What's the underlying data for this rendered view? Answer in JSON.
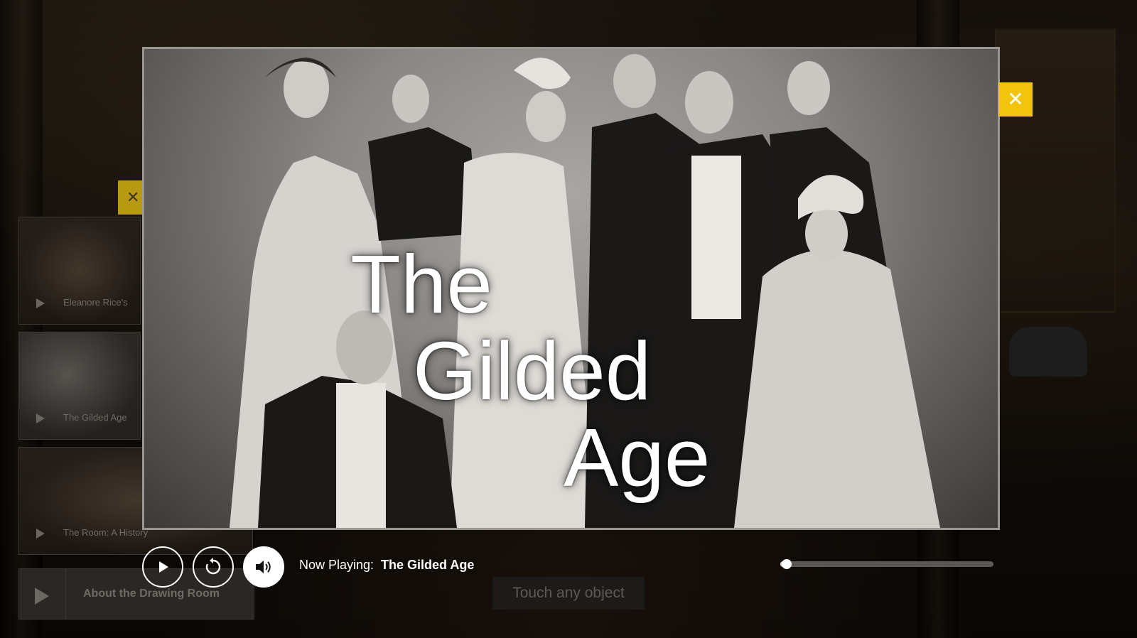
{
  "video": {
    "title_lines": [
      "The",
      "Gilded",
      "Age"
    ]
  },
  "sidebar": {
    "items": [
      {
        "label": "Eleanore Rice's"
      },
      {
        "label": "The Gilded Age"
      },
      {
        "label": "The Room: A History"
      }
    ],
    "about_label": "About the Drawing Room"
  },
  "prompt": "Touch any object",
  "player": {
    "now_playing_label": "Now Playing:",
    "now_playing_title": "The Gilded Age",
    "progress": 0.03
  },
  "colors": {
    "accent": "#f2c40c",
    "control_border": "#ffffff"
  },
  "icons": {
    "close": "close-icon",
    "play": "play-icon",
    "replay": "replay-icon",
    "volume": "volume-icon"
  }
}
